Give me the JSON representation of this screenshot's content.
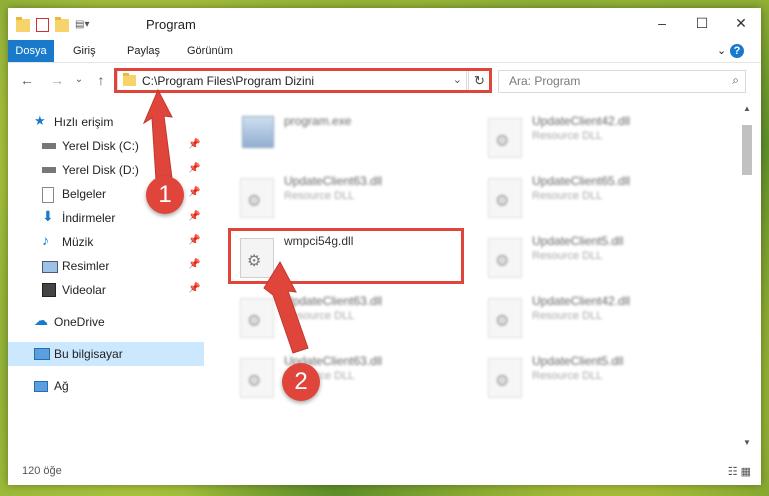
{
  "window": {
    "title": "Program",
    "minimize": "–",
    "maximize": "☐",
    "close": "✕"
  },
  "ribbon": {
    "tabs": [
      "Dosya",
      "Giriş",
      "Paylaş",
      "Görünüm"
    ],
    "expand": "⌄",
    "help": "?"
  },
  "navigation": {
    "back": "←",
    "forward": "→",
    "recent": "⌄",
    "up": "↑",
    "address": "C:\\Program Files\\Program Dizini",
    "address_dropdown": "⌄",
    "refresh": "↻",
    "search_placeholder": "Ara: Program",
    "search_icon": "search-icon"
  },
  "sidebar": {
    "items": [
      {
        "label": "Hızlı erişim",
        "icon": "star-icon",
        "pinned": false
      },
      {
        "label": "Yerel Disk (C:)",
        "icon": "drive-icon",
        "pinned": true
      },
      {
        "label": "Yerel Disk (D:)",
        "icon": "drive-icon",
        "pinned": true
      },
      {
        "label": "Belgeler",
        "icon": "documents-icon",
        "pinned": true
      },
      {
        "label": "İndirmeler",
        "icon": "download-icon",
        "pinned": true
      },
      {
        "label": "Müzik",
        "icon": "music-icon",
        "pinned": true
      },
      {
        "label": "Resimler",
        "icon": "pictures-icon",
        "pinned": true
      },
      {
        "label": "Videolar",
        "icon": "video-icon",
        "pinned": true
      },
      {
        "label": "OneDrive",
        "icon": "cloud-icon",
        "pinned": false
      },
      {
        "label": "Bu bilgisayar",
        "icon": "computer-icon",
        "pinned": false,
        "selected": true
      },
      {
        "label": "Ağ",
        "icon": "network-icon",
        "pinned": false
      }
    ],
    "pin_glyph": "📌"
  },
  "files": [
    {
      "name": "program.exe",
      "type": ""
    },
    {
      "name": "UpdateClient42.dll",
      "type": "Resource DLL"
    },
    {
      "name": "UpdateClient63.dll",
      "type": "Resource DLL"
    },
    {
      "name": "UpdateClient65.dll",
      "type": "Resource DLL"
    },
    {
      "name": "wmpci54g.dll",
      "type": ""
    },
    {
      "name": "UpdateClient5.dll",
      "type": "Resource DLL"
    },
    {
      "name": "UpdateClient63.dll",
      "type": "Resource DLL"
    },
    {
      "name": "UpdateClient42.dll",
      "type": "Resource DLL"
    },
    {
      "name": "UpdateClient63.dll",
      "type": "Resource DLL"
    },
    {
      "name": "UpdateClient5.dll",
      "type": "Resource DLL"
    }
  ],
  "status": {
    "item_count": "120 öğe",
    "view_icons": "☷ ▦"
  },
  "annotations": {
    "step1": "1",
    "step2": "2",
    "color": "#e0453b"
  }
}
